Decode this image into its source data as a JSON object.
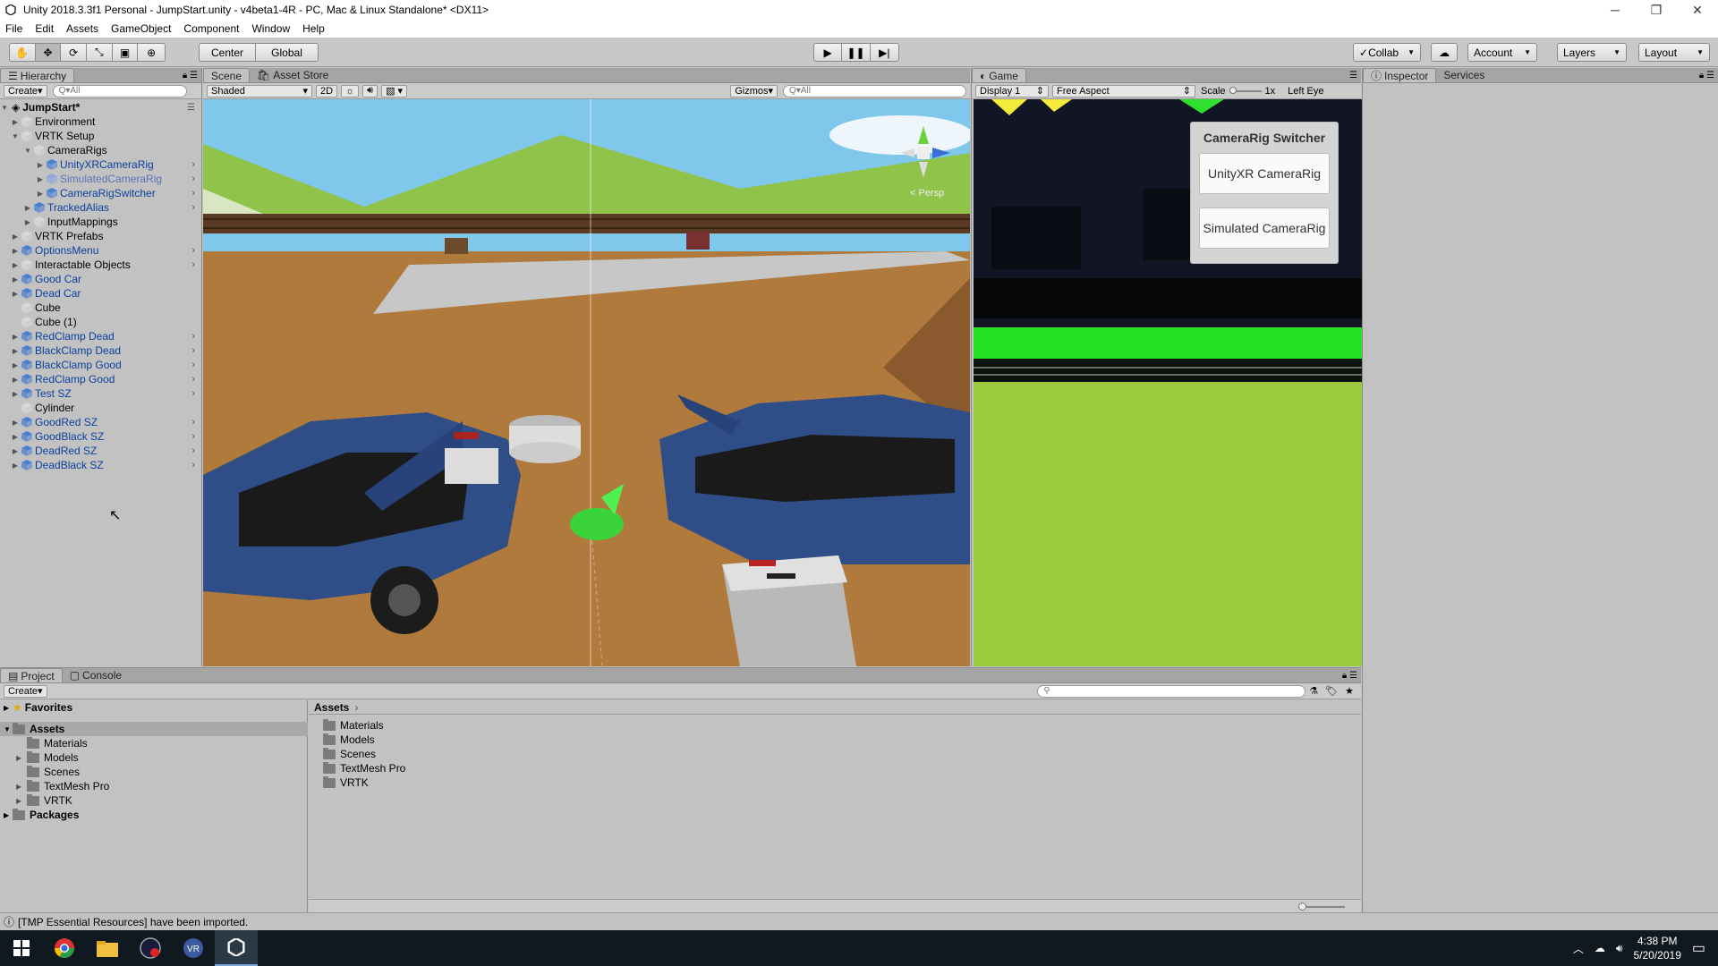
{
  "window": {
    "title": "Unity 2018.3.3f1 Personal - JumpStart.unity - v4beta1-4R - PC, Mac & Linux Standalone* <DX11>"
  },
  "menu": [
    "File",
    "Edit",
    "Assets",
    "GameObject",
    "Component",
    "Window",
    "Help"
  ],
  "toolbar": {
    "center": "Center",
    "global": "Global",
    "collab": "Collab",
    "account": "Account",
    "layers": "Layers",
    "layout": "Layout"
  },
  "hierarchy": {
    "tab": "Hierarchy",
    "create": "Create",
    "search_placeholder": "Q▾All",
    "scene": "JumpStart*",
    "items": [
      {
        "label": "Environment"
      },
      {
        "label": "VRTK Setup"
      },
      {
        "label": "CameraRigs"
      },
      {
        "label": "UnityXRCameraRig"
      },
      {
        "label": "SimulatedCameraRig"
      },
      {
        "label": "CameraRigSwitcher"
      },
      {
        "label": "TrackedAlias"
      },
      {
        "label": "InputMappings"
      },
      {
        "label": "VRTK Prefabs"
      },
      {
        "label": "OptionsMenu"
      },
      {
        "label": "Interactable Objects"
      },
      {
        "label": "Good Car"
      },
      {
        "label": "Dead Car"
      },
      {
        "label": "Cube"
      },
      {
        "label": "Cube (1)"
      },
      {
        "label": "RedClamp Dead"
      },
      {
        "label": "BlackClamp Dead"
      },
      {
        "label": "BlackClamp Good"
      },
      {
        "label": "RedClamp Good"
      },
      {
        "label": "Test SZ"
      },
      {
        "label": "Cylinder"
      },
      {
        "label": "GoodRed SZ"
      },
      {
        "label": "GoodBlack SZ"
      },
      {
        "label": "DeadRed SZ"
      },
      {
        "label": "DeadBlack SZ"
      }
    ]
  },
  "scene_view": {
    "tab_scene": "Scene",
    "tab_store": "Asset Store",
    "shading": "Shaded",
    "mode_2d": "2D",
    "gizmos": "Gizmos",
    "search": "Q▾All",
    "persp": "< Persp"
  },
  "game_view": {
    "tab": "Game",
    "display": "Display 1",
    "aspect": "Free Aspect",
    "scale_label": "Scale",
    "scale_value": "1x",
    "eye": "Left Eye",
    "switcher_title": "CameraRig Switcher",
    "btn_unity": "UnityXR CameraRig",
    "btn_sim": "Simulated CameraRig"
  },
  "inspector": {
    "tab": "Inspector",
    "services": "Services"
  },
  "project": {
    "tab": "Project",
    "console": "Console",
    "create": "Create",
    "favorites": "Favorites",
    "assets": "Assets",
    "packages": "Packages",
    "tree": [
      "Materials",
      "Models",
      "Scenes",
      "TextMesh Pro",
      "VRTK"
    ],
    "breadcrumb": "Assets",
    "list": [
      "Materials",
      "Models",
      "Scenes",
      "TextMesh Pro",
      "VRTK"
    ]
  },
  "status": {
    "message": "[TMP Essential Resources] have been imported."
  },
  "taskbar": {
    "time": "4:38 PM",
    "date": "5/20/2019"
  }
}
